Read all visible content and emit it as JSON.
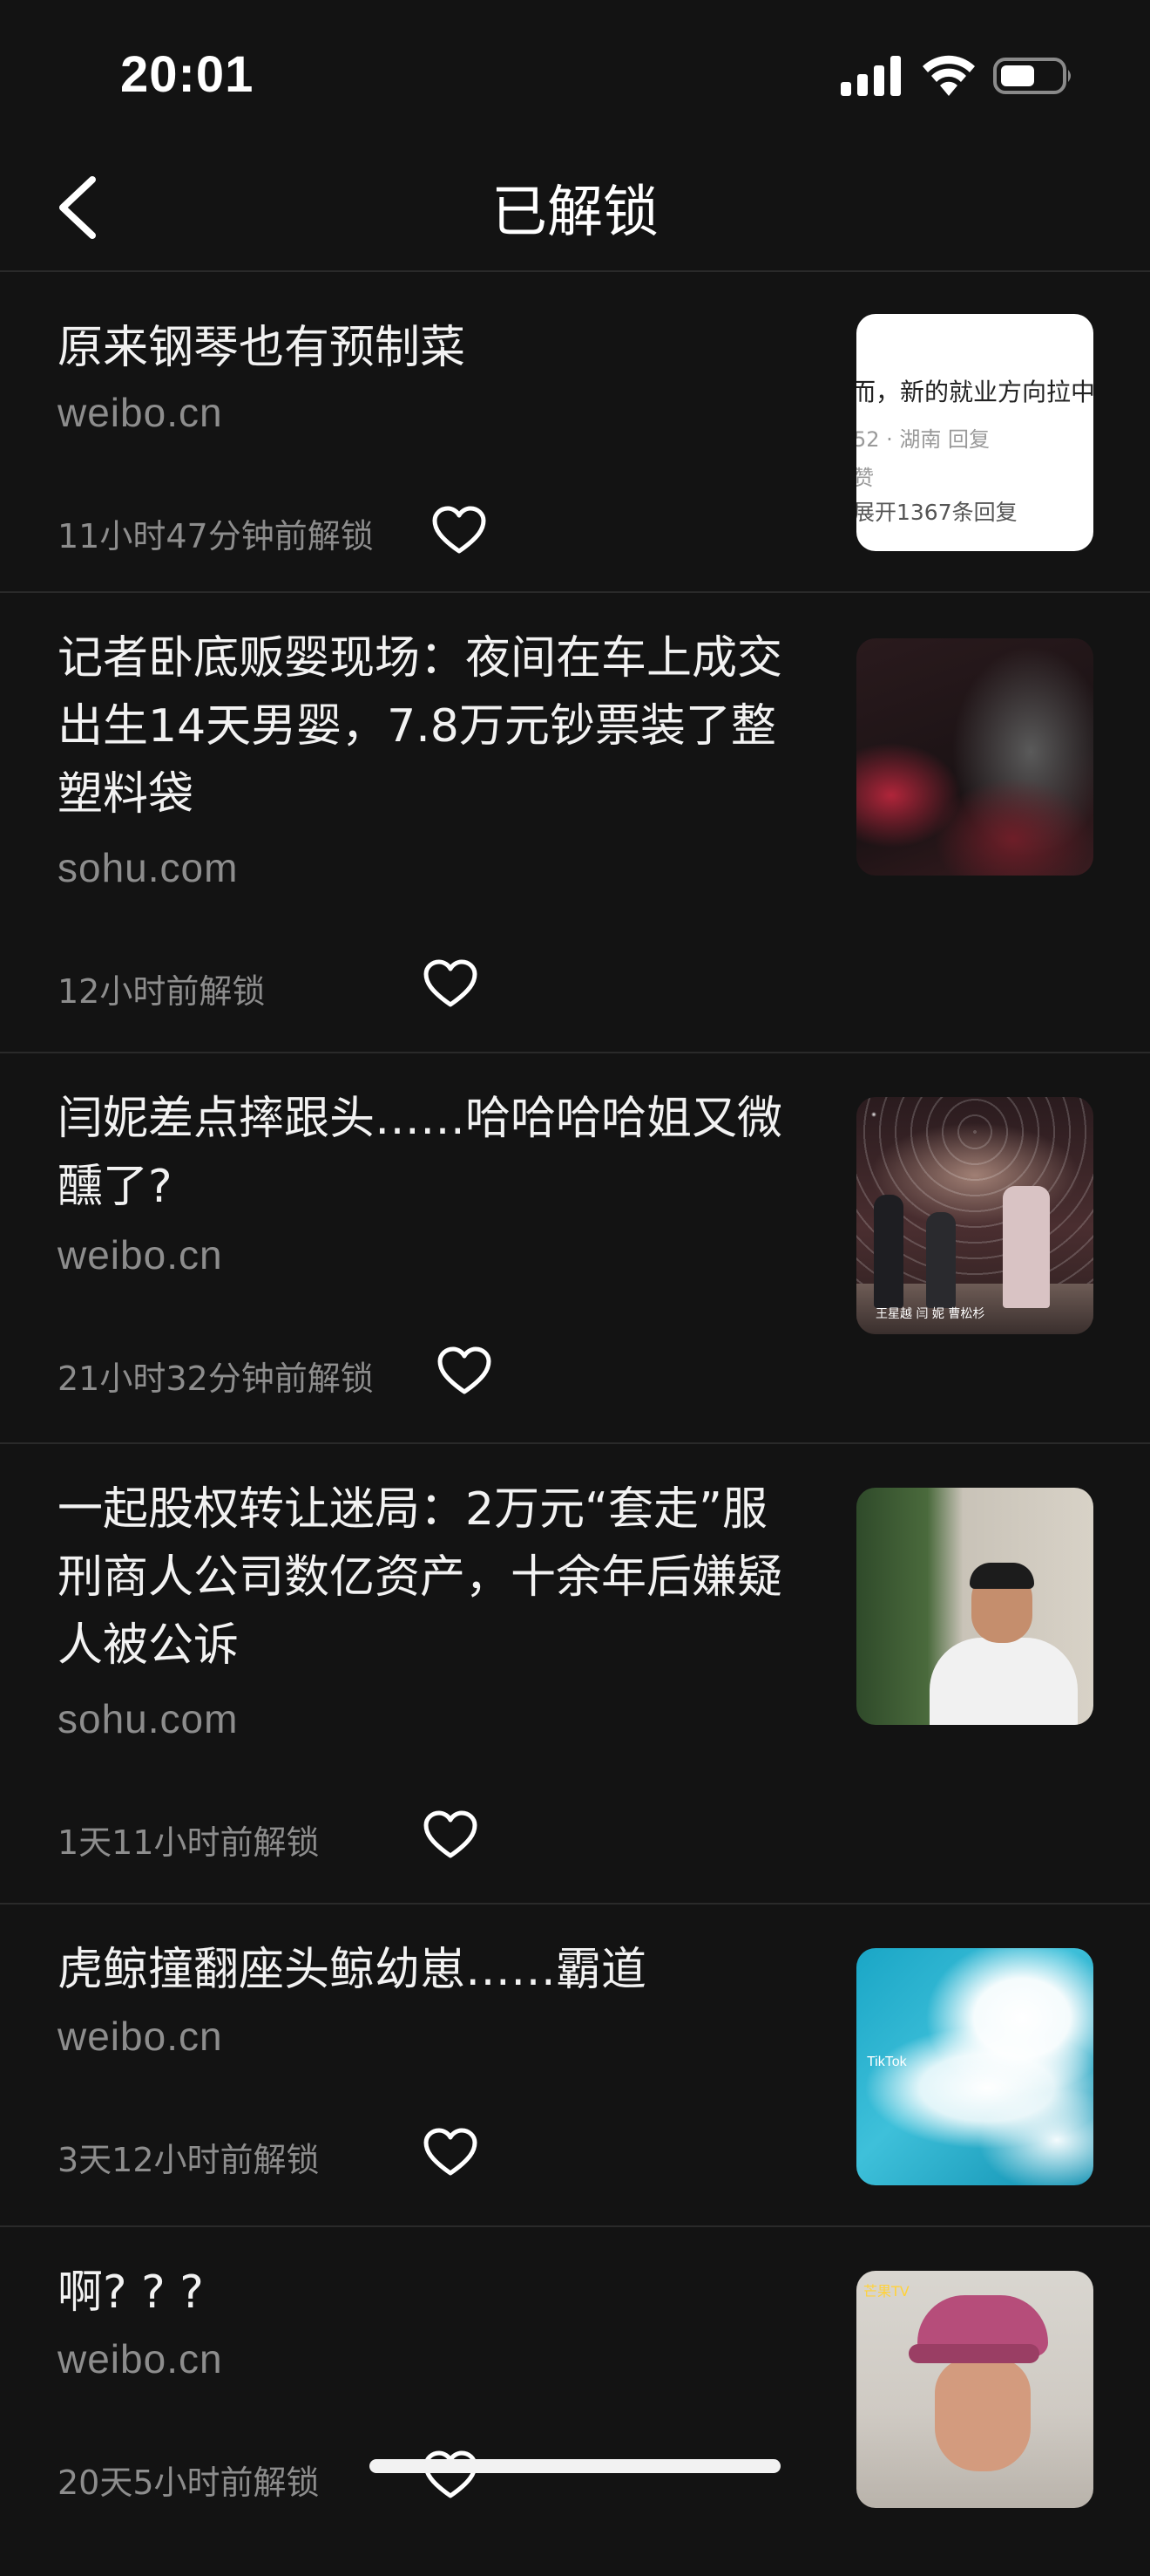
{
  "status_bar": {
    "time": "20:01"
  },
  "nav": {
    "title": "已解锁"
  },
  "items": [
    {
      "title_lines": [
        "原来钢琴也有预制菜"
      ],
      "source": "weibo.cn",
      "time": "11小时47分钟前解锁",
      "thumb_text": {
        "line1": "而，新的就业方向拉中",
        "line2": "52 · 湖南   回复",
        "line3": "赞",
        "line4": "展开1367条回复"
      }
    },
    {
      "title_lines": [
        "记者卧底贩婴现场：夜间在车上成交",
        "出生14天男婴，7.8万元钞票装了整",
        "塑料袋"
      ],
      "source": "sohu.com",
      "time": "12小时前解锁"
    },
    {
      "title_lines": [
        "闫妮差点摔跟头……哈哈哈哈姐又微",
        "醺了?"
      ],
      "source": "weibo.cn",
      "time": "21小时32分钟前解锁",
      "thumb_caption": "王星越    闫 妮    曹松杉"
    },
    {
      "title_lines": [
        "一起股权转让迷局：2万元“套走”服",
        "刑商人公司数亿资产，十余年后嫌疑",
        "人被公诉"
      ],
      "source": "sohu.com",
      "time": "1天11小时前解锁"
    },
    {
      "title_lines": [
        "虎鲸撞翻座头鲸幼崽……霸道"
      ],
      "source": "weibo.cn",
      "time": "3天12小时前解锁",
      "thumb_text": "TikTok"
    },
    {
      "title_lines": [
        "啊? ? ?"
      ],
      "source": "weibo.cn",
      "time": "20天5小时前解锁",
      "thumb_text": "芒果TV"
    }
  ]
}
